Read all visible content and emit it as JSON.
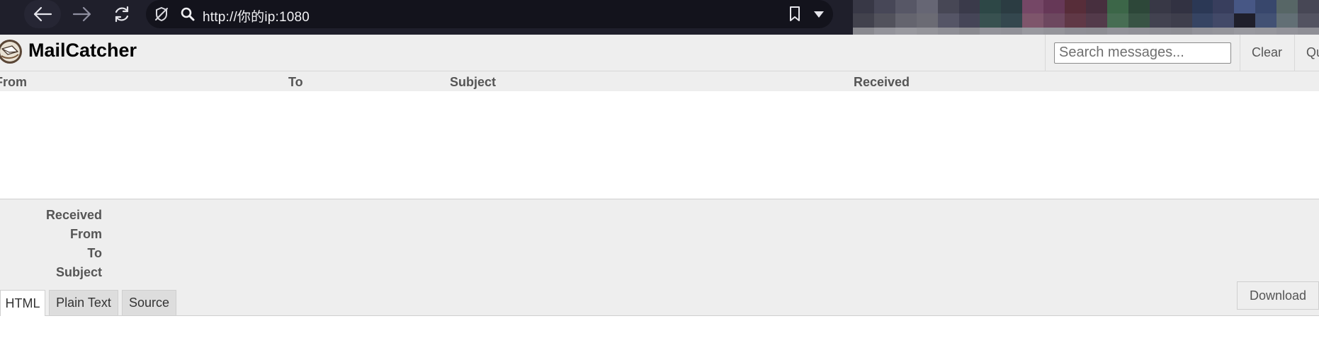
{
  "browser": {
    "url": "http://你的ip:1080",
    "mosaic_colors": [
      "#3a3a48",
      "#4a4a5a",
      "#5a5a6a",
      "#6a6a78",
      "#4a4a58",
      "#3c3c4c",
      "#2e4a48",
      "#2c3e44",
      "#7a4a6a",
      "#6a3a5a",
      "#5a2e3a",
      "#4a3040",
      "#3e6a4a",
      "#2e4a3a",
      "#3a3a48",
      "#343444",
      "#2c3a58",
      "#3a4060",
      "#4a5a8a",
      "#3a4a70",
      "#5a6a6a",
      "#4a4a58",
      "#44444f",
      "#55555f",
      "#686872",
      "#707078",
      "#58586a",
      "#48485a",
      "#3a5452",
      "#364a50",
      "#84586f",
      "#724a62",
      "#643a48",
      "#563c4c",
      "#4a7256",
      "#3a5646",
      "#444452",
      "#40404e",
      "#384666",
      "#444c6c",
      "#5466928",
      "#445478",
      "#66747a",
      "#565664",
      "#8f8f95",
      "#9a9aa0",
      "#a0a0a6",
      "#9c9ca2",
      "#96969c",
      "#909096",
      "#9a9aa0",
      "#98989e",
      "#a0a0a6",
      "#9c9ca2",
      "#96969c",
      "#94949a",
      "#9a9aa0",
      "#98989e",
      "#96969c",
      "#94949a",
      "#9a9aa0",
      "#9c9ca2",
      "#a0a0a6",
      "#9e9ea4",
      "#9a9aa0",
      "#96969c"
    ]
  },
  "header": {
    "title": "MailCatcher",
    "search_placeholder": "Search messages...",
    "clear_label": "Clear",
    "quit_label": "Quit"
  },
  "message_list": {
    "columns": [
      "From",
      "To",
      "Subject",
      "Received"
    ],
    "rows": []
  },
  "message_detail": {
    "labels": [
      "Received",
      "From",
      "To",
      "Subject"
    ],
    "tabs": [
      {
        "label": "HTML",
        "active": true
      },
      {
        "label": "Plain Text",
        "active": false
      },
      {
        "label": "Source",
        "active": false
      }
    ],
    "download_label": "Download"
  }
}
